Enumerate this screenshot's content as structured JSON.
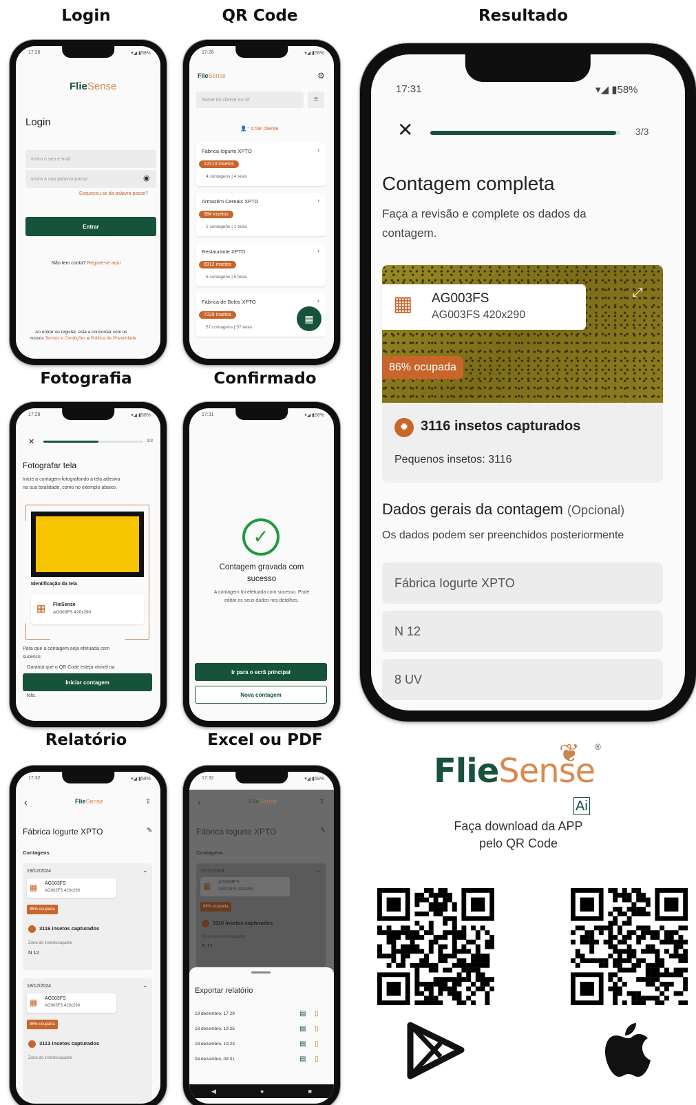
{
  "captions": {
    "login": "Login",
    "qr": "QR Code",
    "resultado": "Resultado",
    "fotografia": "Fotografia",
    "confirmado": "Confirmado",
    "relatorio": "Relatório",
    "excel": "Excel ou PDF"
  },
  "brand": {
    "flie": "Flie",
    "sense": "Sense",
    "ai": "Ai",
    "reg": "®",
    "download": "Faça  download da APP",
    "download2": "pelo QR Code",
    "mini_flie": "Flie",
    "mini_sense": "Sense"
  },
  "login": {
    "time": "17:26",
    "status": "▾◢ ▮58%",
    "title": "Login",
    "email_placeholder": "Insira o seu e-mail",
    "password_placeholder": "Insira a sua palavra-passe",
    "forgot": "Esqueceu-se da palavra passe?",
    "enter": "Entrar",
    "no_account": "Não tem conta?",
    "register": "Registe-se aqui",
    "terms1": "Ao entrar ou registar, está a concordar com os",
    "terms2a": "nossos",
    "terms2b": "Termos e Condições",
    "terms2c": "e",
    "terms2d": "Política de Privacidade"
  },
  "qrcode": {
    "time": "17:26",
    "status": "▾◢ ▮58%",
    "search_placeholder": "Nome do cliente ou nif",
    "create_client": "Criar cliente",
    "clients": [
      {
        "name": "Fábrica Iogurte XPTO",
        "badge": "12210 insetos",
        "meta": "4 contagens | 4 telas"
      },
      {
        "name": "Armazém Cereais XPTO",
        "badge": "384 insetos",
        "meta": "1 contagens | 1 telas"
      },
      {
        "name": "Restaurante XPTO",
        "badge": "6912 insetos",
        "meta": "5 contagens | 5 telas"
      },
      {
        "name": "Fábrica de Bolos XPTO",
        "badge": "7229 insetos",
        "meta": "57 contagens | 57 telas"
      }
    ]
  },
  "resultado": {
    "time": "17:31",
    "status": "58%",
    "progress": 0.98,
    "step": "3/3",
    "title": "Contagem completa",
    "subtitle1": "Faça a revisão e complete os dados da",
    "subtitle2": "contagem.",
    "trap_id": "AG003FS",
    "trap_desc": "AG003FS 420x290",
    "occupied": "86% ocupada",
    "captured": "3116 insetos capturados",
    "small": "Pequenos insetos: 3116",
    "section": "Dados gerais da contagem",
    "optional": "(Opcional)",
    "section_hint": "Os dados podem ser preenchidos posteriormente",
    "fields": [
      "Fábrica Iogurte XPTO",
      "N 12",
      "8 UV"
    ]
  },
  "fotografia": {
    "time": "17:28",
    "status": "▾◢ ▮58%",
    "progress": 0.55,
    "step": "2/3",
    "title": "Fotografar tela",
    "desc1": "Inicie a contagem fotografando a tela adesiva",
    "desc2": "na sua totalidade, como no exemplo abaixo.",
    "id_label": "Identificação da tela",
    "card_title": "FlieSense",
    "card_sub": "AG003FS 420x290",
    "hint1": "Para que a contagem seja efetuada com",
    "hint2": "sucesso:",
    "hint3": "Garanta que o QR Code esteja visível na",
    "hint4": "tela.",
    "button": "Iniciar contagem",
    "screen_color": "#f6c400"
  },
  "confirmado": {
    "time": "17:31",
    "status": "▾◢ ▮58%",
    "title1": "Contagem gravada com",
    "title2": "sucesso",
    "desc1": "A contagem foi efetuada com sucesso. Pode",
    "desc2": "editar os seus dados nos detalhes.",
    "primary": "Ir para o ecrã principal",
    "secondary": "Nova contagem"
  },
  "relatorio": {
    "time": "17:32",
    "status": "▾◢ ▮58%",
    "title": "Fábrica Iogurte XPTO",
    "section": "Contagens",
    "entries": [
      {
        "date": "19/12/2024",
        "trap": "AG003FS",
        "trap_sub": "AG003FS 420x290",
        "occupied": "86% ocupada",
        "captured": "3116 insetos capturados",
        "zone_label": "Zona do insectocaçador",
        "zone": "N 12"
      },
      {
        "date": "18/12/2024",
        "trap": "AG003FS",
        "trap_sub": "AG003FS 420x290",
        "occupied": "86% ocupada",
        "captured": "3113 insetos capturados",
        "zone_label": "Zona do insectocaçador",
        "zone": ""
      }
    ]
  },
  "excel": {
    "time": "17:32",
    "status": "▾◢ ▮58%",
    "title": "Fábrica Iogurte XPTO",
    "section": "Contagens",
    "date": "19/12/2024",
    "trap": "AG003FS",
    "trap_sub": "AG003FS 420x290",
    "occupied": "86% ocupada",
    "captured": "3116 insetos capturados",
    "zone_label": "Zona do insectocaçador",
    "zone": "N 12",
    "sheet_title": "Exportar relatório",
    "reports": [
      "19 dezembro, 17:29",
      "18 dezembro, 10:25",
      "18 dezembro, 10:23",
      "04 dezembro, 09:31"
    ]
  },
  "colors": {
    "green": "#16533a",
    "orange": "#c9652a",
    "trap": "#8a7a1c"
  }
}
